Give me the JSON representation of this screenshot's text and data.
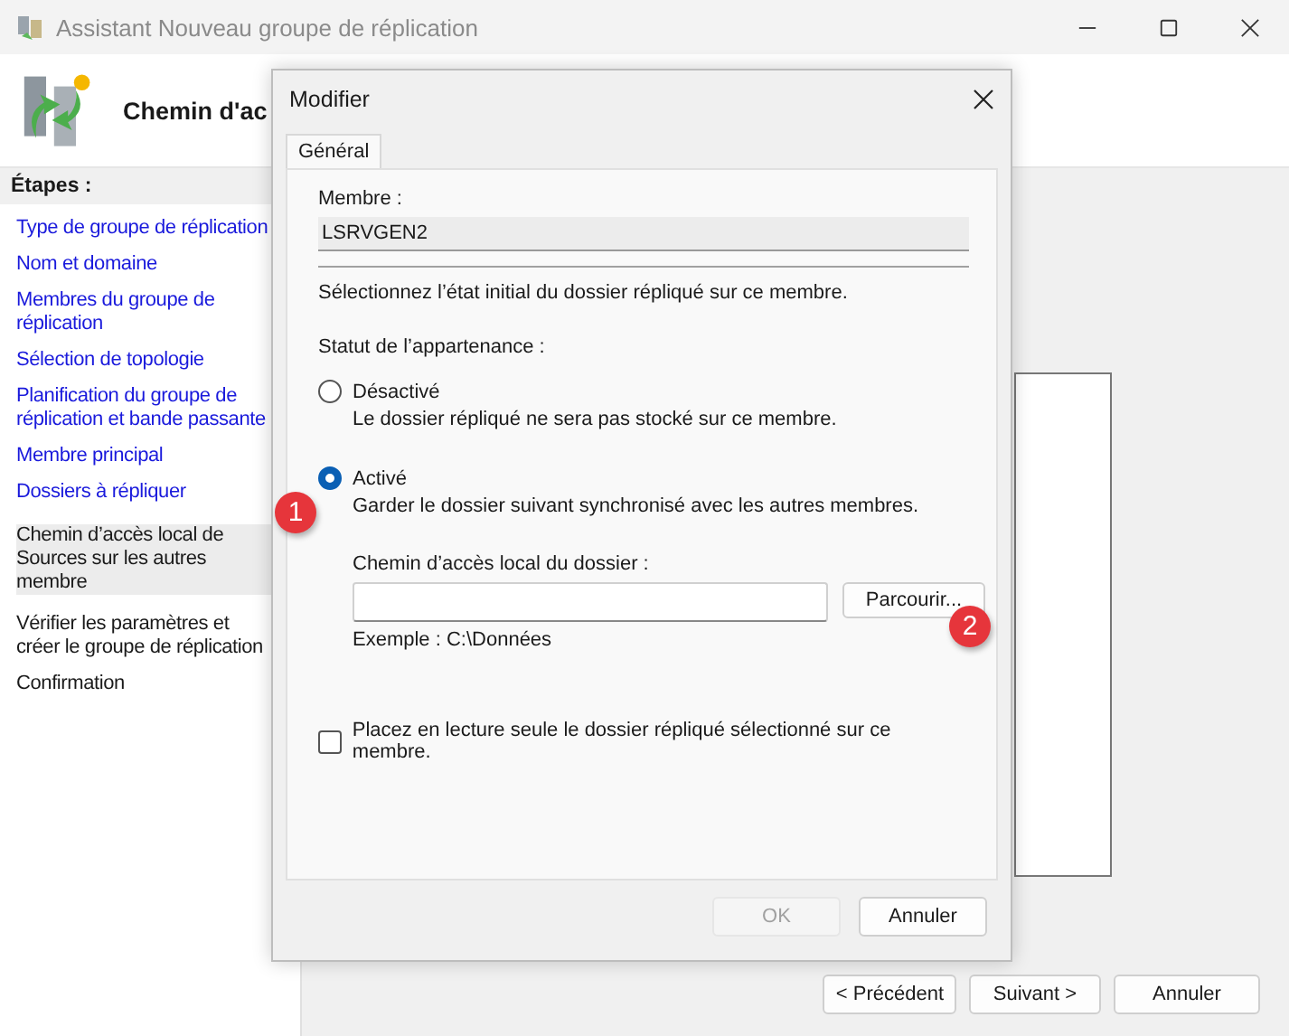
{
  "window": {
    "title": "Assistant Nouveau groupe de réplication"
  },
  "header": {
    "title": "Chemin d'ac"
  },
  "sidebar": {
    "heading": "Étapes :",
    "items": [
      {
        "label": "Type de groupe de réplication",
        "kind": "done",
        "selected": false
      },
      {
        "label": "Nom et domaine",
        "kind": "done",
        "selected": false
      },
      {
        "label": "Membres du groupe de réplication",
        "kind": "done",
        "selected": false
      },
      {
        "label": "Sélection de topologie",
        "kind": "done",
        "selected": false
      },
      {
        "label": "Planification du groupe de réplication et bande passante",
        "kind": "done",
        "selected": false
      },
      {
        "label": "Membre principal",
        "kind": "done",
        "selected": false
      },
      {
        "label": "Dossiers à répliquer",
        "kind": "done",
        "selected": false
      },
      {
        "label": "Chemin d’accès local de Sources sur les autres membre",
        "kind": "pending",
        "selected": true
      },
      {
        "label": "Vérifier les paramètres et créer le groupe de réplication",
        "kind": "pending",
        "selected": false
      },
      {
        "label": "Confirmation",
        "kind": "pending",
        "selected": false
      }
    ]
  },
  "footer_buttons": [
    {
      "label": "< Précédent",
      "disabled": false
    },
    {
      "label": "Suivant >",
      "disabled": false
    },
    {
      "label": "Annuler",
      "disabled": false
    }
  ],
  "dialog": {
    "title": "Modifier",
    "tabs": [
      {
        "label": "Général",
        "selected": true
      }
    ],
    "member_label": "Membre :",
    "member_value": "LSRVGEN2",
    "instruction": "Sélectionnez l’état initial du dossier répliqué sur ce membre.",
    "status_label": "Statut de l’appartenance :",
    "options": [
      {
        "label": "Désactivé",
        "description": "Le dossier répliqué ne sera pas stocké sur ce membre.",
        "selected": false
      },
      {
        "label": "Activé",
        "description": "Garder le dossier suivant synchronisé avec les autres membres.",
        "selected": true
      }
    ],
    "path_label": "Chemin d’accès local du dossier :",
    "browse_button": "Parcourir...",
    "example": "Exemple : C:\\Données",
    "readonly": {
      "label": "Placez en lecture seule le dossier répliqué sélectionné sur ce membre.",
      "checked": false
    },
    "buttons": [
      {
        "label": "OK",
        "disabled": true
      },
      {
        "label": "Annuler",
        "disabled": false
      }
    ]
  },
  "badges": [
    "1",
    "2"
  ]
}
